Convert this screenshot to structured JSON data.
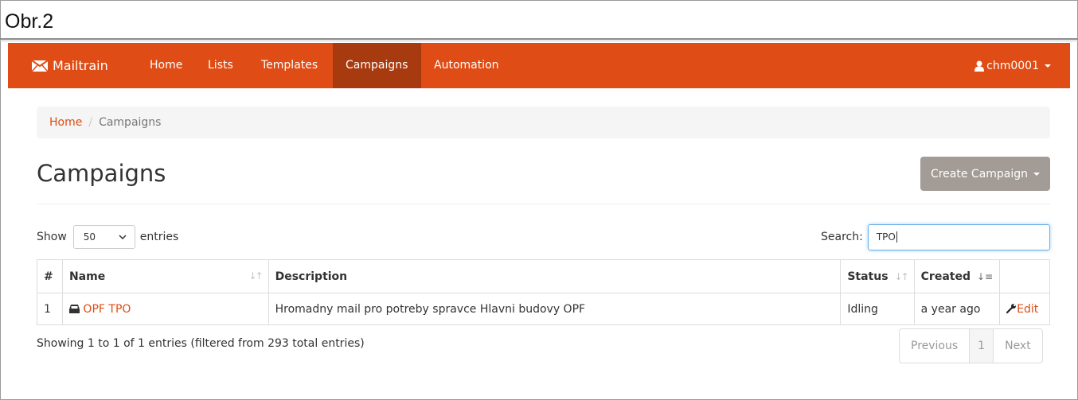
{
  "caption": "Obr.2",
  "navbar": {
    "brand": "Mailtrain",
    "items": [
      "Home",
      "Lists",
      "Templates",
      "Campaigns",
      "Automation"
    ],
    "active": "Campaigns",
    "user": "chm0001",
    "color": "#df4c15",
    "active_color": "#a83a10"
  },
  "breadcrumb": {
    "home": "Home",
    "separator": "/",
    "current": "Campaigns"
  },
  "page": {
    "title": "Campaigns",
    "create_button": "Create Campaign"
  },
  "filters": {
    "show_label": "Show",
    "entries_value": "50",
    "entries_label": "entries",
    "search_label": "Search:",
    "search_value": "TPO"
  },
  "table": {
    "headers": {
      "num": "#",
      "name": "Name",
      "description": "Description",
      "status": "Status",
      "created": "Created"
    },
    "rows": [
      {
        "num": "1",
        "name": "OPF TPO",
        "description": "Hromadny mail pro potreby spravce Hlavni budovy OPF",
        "status": "Idling",
        "created": "a year ago",
        "action": "Edit"
      }
    ]
  },
  "footer": {
    "info": "Showing 1 to 1 of 1 entries (filtered from 293 total entries)",
    "previous": "Previous",
    "page": "1",
    "next": "Next"
  }
}
